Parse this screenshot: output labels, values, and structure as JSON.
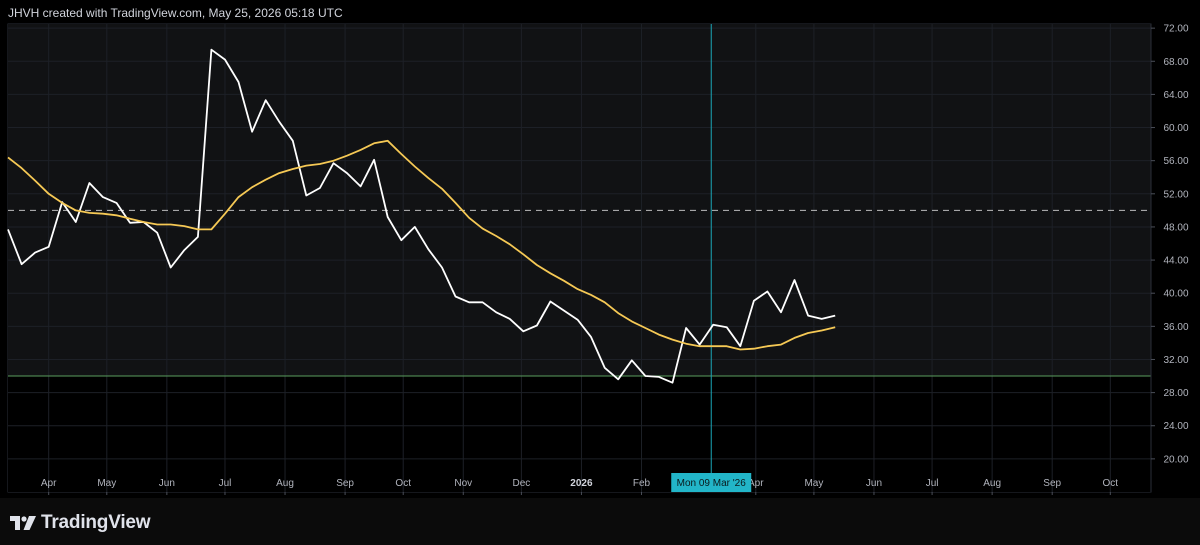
{
  "header": {
    "caption": "JHVH created with TradingView.com, May 25, 2026 05:18 UTC"
  },
  "branding": {
    "name": "TradingView"
  },
  "colors": {
    "price_line": "#ffffff",
    "ma_line": "#f6c955",
    "level_30": "#5a9e5e",
    "level_50_dashed": "#bcbcbc",
    "crosshair": "#1aa7b8",
    "crosshair_label_bg": "#22b5c8"
  },
  "crosshair": {
    "label": "Mon 09 Mar '26",
    "date": "2026-03-09"
  },
  "chart_data": {
    "type": "line",
    "y_axis": {
      "ticks": [
        "72.00",
        "68.00",
        "64.00",
        "60.00",
        "56.00",
        "52.00",
        "48.00",
        "44.00",
        "40.00",
        "36.00",
        "32.00",
        "28.00",
        "24.00",
        "20.00"
      ],
      "range": [
        16,
        72.5
      ]
    },
    "x_axis": {
      "labels": [
        {
          "text": "Apr",
          "date": "2025-04-01"
        },
        {
          "text": "May",
          "date": "2025-05-01"
        },
        {
          "text": "Jun",
          "date": "2025-06-01"
        },
        {
          "text": "Jul",
          "date": "2025-07-01"
        },
        {
          "text": "Aug",
          "date": "2025-08-01"
        },
        {
          "text": "Sep",
          "date": "2025-09-01"
        },
        {
          "text": "Oct",
          "date": "2025-10-01"
        },
        {
          "text": "Nov",
          "date": "2025-11-01"
        },
        {
          "text": "Dec",
          "date": "2025-12-01"
        },
        {
          "text": "2026",
          "date": "2026-01-01",
          "bold": true
        },
        {
          "text": "Feb",
          "date": "2026-02-01"
        },
        {
          "text": "Apr",
          "date": "2026-04-01"
        },
        {
          "text": "May",
          "date": "2026-05-01"
        },
        {
          "text": "Jun",
          "date": "2026-06-01"
        },
        {
          "text": "Jul",
          "date": "2026-07-01"
        },
        {
          "text": "Aug",
          "date": "2026-08-01"
        },
        {
          "text": "Sep",
          "date": "2026-09-01"
        },
        {
          "text": "Oct",
          "date": "2026-10-01"
        }
      ],
      "range": [
        "2025-03-11",
        "2026-10-22"
      ]
    },
    "horizontal_lines": [
      {
        "value": 50,
        "style": "dashed"
      },
      {
        "value": 30,
        "style": "solid"
      }
    ],
    "shaded_below": 30,
    "grid": true,
    "series": [
      {
        "style": "price",
        "points": [
          [
            "2025-03-11",
            47.7
          ],
          [
            "2025-03-18",
            43.5
          ],
          [
            "2025-03-25",
            44.9
          ],
          [
            "2025-04-01",
            45.6
          ],
          [
            "2025-04-08",
            51.0
          ],
          [
            "2025-04-15",
            48.6
          ],
          [
            "2025-04-22",
            53.3
          ],
          [
            "2025-04-29",
            51.6
          ],
          [
            "2025-05-06",
            50.9
          ],
          [
            "2025-05-13",
            48.5
          ],
          [
            "2025-05-20",
            48.6
          ],
          [
            "2025-05-27",
            47.3
          ],
          [
            "2025-06-03",
            43.1
          ],
          [
            "2025-06-10",
            45.2
          ],
          [
            "2025-06-17",
            46.8
          ],
          [
            "2025-06-24",
            69.4
          ],
          [
            "2025-07-01",
            68.2
          ],
          [
            "2025-07-08",
            65.5
          ],
          [
            "2025-07-15",
            59.5
          ],
          [
            "2025-07-22",
            63.3
          ],
          [
            "2025-07-29",
            60.7
          ],
          [
            "2025-08-05",
            58.4
          ],
          [
            "2025-08-12",
            51.8
          ],
          [
            "2025-08-19",
            52.7
          ],
          [
            "2025-08-26",
            55.7
          ],
          [
            "2025-09-02",
            54.5
          ],
          [
            "2025-09-09",
            52.9
          ],
          [
            "2025-09-16",
            56.1
          ],
          [
            "2025-09-23",
            49.2
          ],
          [
            "2025-09-30",
            46.4
          ],
          [
            "2025-10-07",
            48.0
          ],
          [
            "2025-10-14",
            45.3
          ],
          [
            "2025-10-21",
            43.1
          ],
          [
            "2025-10-28",
            39.6
          ],
          [
            "2025-11-04",
            38.9
          ],
          [
            "2025-11-11",
            38.9
          ],
          [
            "2025-11-18",
            37.7
          ],
          [
            "2025-11-25",
            36.9
          ],
          [
            "2025-12-02",
            35.4
          ],
          [
            "2025-12-09",
            36.1
          ],
          [
            "2025-12-16",
            39.0
          ],
          [
            "2025-12-23",
            37.9
          ],
          [
            "2025-12-30",
            36.8
          ],
          [
            "2026-01-06",
            34.7
          ],
          [
            "2026-01-13",
            31.0
          ],
          [
            "2026-01-20",
            29.6
          ],
          [
            "2026-01-27",
            31.9
          ],
          [
            "2026-02-03",
            30.0
          ],
          [
            "2026-02-10",
            29.9
          ],
          [
            "2026-02-17",
            29.2
          ],
          [
            "2026-02-24",
            35.8
          ],
          [
            "2026-03-03",
            33.8
          ],
          [
            "2026-03-10",
            36.2
          ],
          [
            "2026-03-17",
            35.9
          ],
          [
            "2026-03-24",
            33.6
          ],
          [
            "2026-03-31",
            39.1
          ],
          [
            "2026-04-07",
            40.2
          ],
          [
            "2026-04-14",
            37.7
          ],
          [
            "2026-04-21",
            41.6
          ],
          [
            "2026-04-28",
            37.3
          ],
          [
            "2026-05-05",
            36.9
          ],
          [
            "2026-05-12",
            37.3
          ]
        ]
      },
      {
        "style": "moving_average",
        "points": [
          [
            "2025-03-11",
            56.4
          ],
          [
            "2025-03-18",
            55.1
          ],
          [
            "2025-03-25",
            53.6
          ],
          [
            "2025-04-01",
            52.0
          ],
          [
            "2025-04-08",
            50.9
          ],
          [
            "2025-04-15",
            50.0
          ],
          [
            "2025-04-22",
            49.7
          ],
          [
            "2025-04-29",
            49.6
          ],
          [
            "2025-05-06",
            49.4
          ],
          [
            "2025-05-13",
            49.0
          ],
          [
            "2025-05-20",
            48.6
          ],
          [
            "2025-05-27",
            48.3
          ],
          [
            "2025-06-03",
            48.3
          ],
          [
            "2025-06-10",
            48.1
          ],
          [
            "2025-06-17",
            47.7
          ],
          [
            "2025-06-24",
            47.7
          ],
          [
            "2025-07-01",
            49.6
          ],
          [
            "2025-07-08",
            51.6
          ],
          [
            "2025-07-15",
            52.8
          ],
          [
            "2025-07-22",
            53.7
          ],
          [
            "2025-07-29",
            54.5
          ],
          [
            "2025-08-05",
            55.0
          ],
          [
            "2025-08-12",
            55.4
          ],
          [
            "2025-08-19",
            55.6
          ],
          [
            "2025-08-26",
            56.0
          ],
          [
            "2025-09-02",
            56.6
          ],
          [
            "2025-09-09",
            57.3
          ],
          [
            "2025-09-16",
            58.1
          ],
          [
            "2025-09-23",
            58.4
          ],
          [
            "2025-09-30",
            56.8
          ],
          [
            "2025-10-07",
            55.3
          ],
          [
            "2025-10-14",
            53.9
          ],
          [
            "2025-10-21",
            52.6
          ],
          [
            "2025-10-28",
            50.9
          ],
          [
            "2025-11-04",
            49.1
          ],
          [
            "2025-11-11",
            47.8
          ],
          [
            "2025-11-18",
            46.9
          ],
          [
            "2025-11-25",
            45.9
          ],
          [
            "2025-12-02",
            44.7
          ],
          [
            "2025-12-09",
            43.4
          ],
          [
            "2025-12-16",
            42.4
          ],
          [
            "2025-12-23",
            41.5
          ],
          [
            "2025-12-30",
            40.5
          ],
          [
            "2026-01-06",
            39.8
          ],
          [
            "2026-01-13",
            38.9
          ],
          [
            "2026-01-20",
            37.6
          ],
          [
            "2026-01-27",
            36.6
          ],
          [
            "2026-02-03",
            35.8
          ],
          [
            "2026-02-10",
            35.0
          ],
          [
            "2026-02-17",
            34.4
          ],
          [
            "2026-02-24",
            33.9
          ],
          [
            "2026-03-03",
            33.6
          ],
          [
            "2026-03-10",
            33.6
          ],
          [
            "2026-03-17",
            33.6
          ],
          [
            "2026-03-24",
            33.2
          ],
          [
            "2026-03-31",
            33.3
          ],
          [
            "2026-04-07",
            33.6
          ],
          [
            "2026-04-14",
            33.8
          ],
          [
            "2026-04-21",
            34.6
          ],
          [
            "2026-04-28",
            35.2
          ],
          [
            "2026-05-05",
            35.5
          ],
          [
            "2026-05-12",
            35.9
          ]
        ]
      }
    ]
  }
}
